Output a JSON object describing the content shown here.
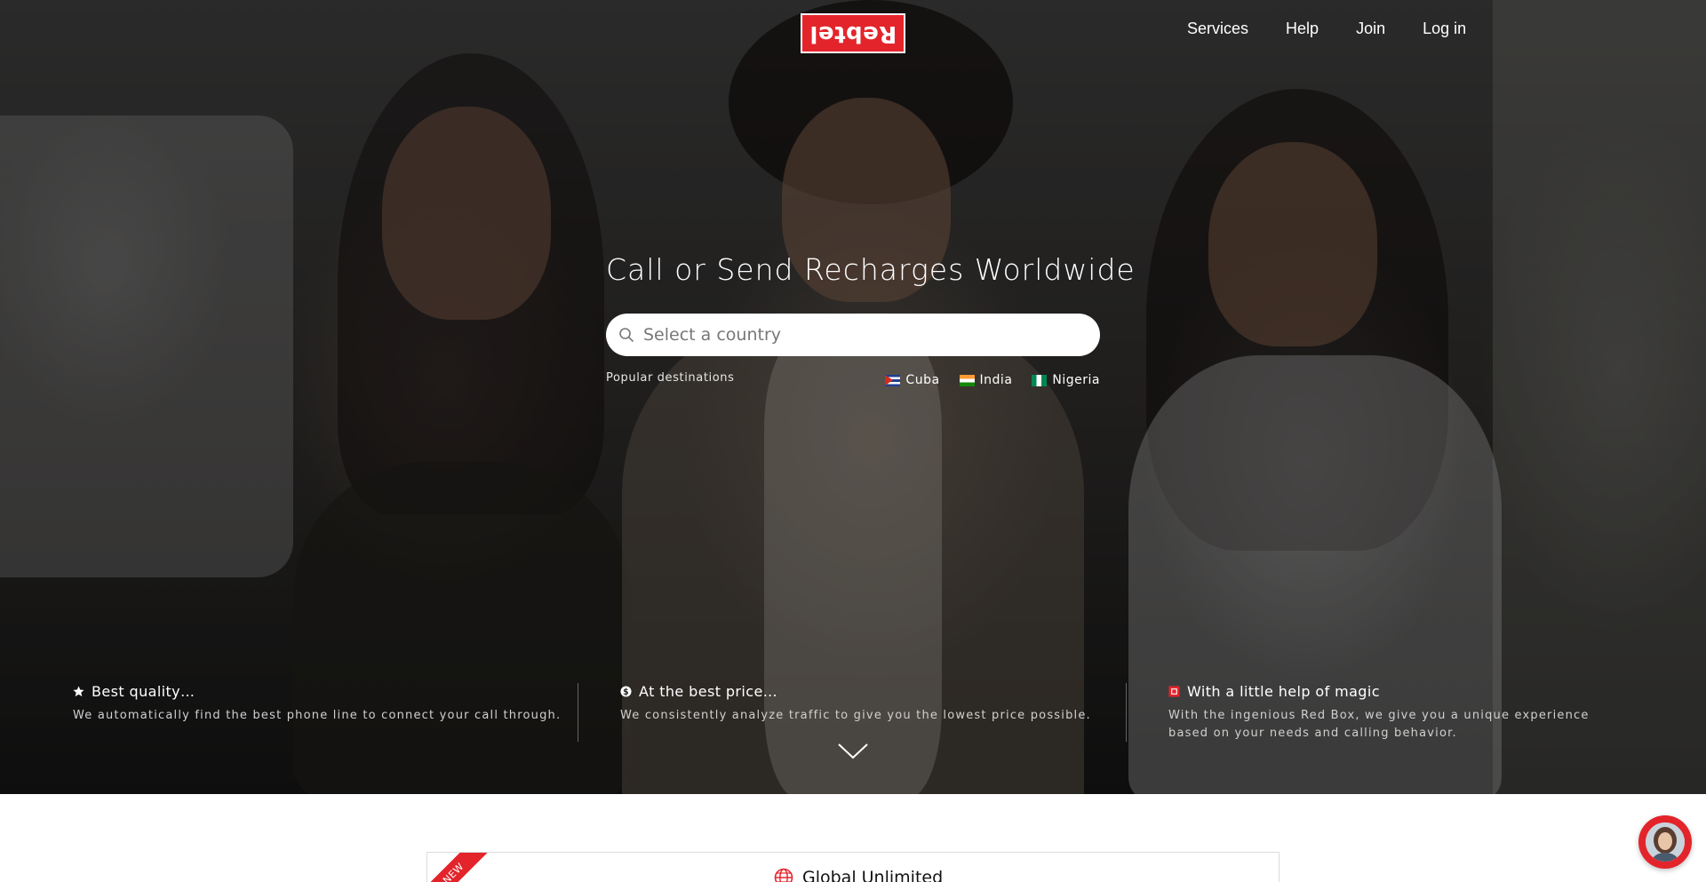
{
  "brand": {
    "logo_text": "Rebtel",
    "accent_color": "#e3242b"
  },
  "nav": {
    "items": [
      {
        "label": "Services"
      },
      {
        "label": "Help"
      },
      {
        "label": "Join"
      },
      {
        "label": "Log in"
      }
    ]
  },
  "hero": {
    "headline": "Call or Send Recharges Worldwide",
    "search": {
      "placeholder": "Select a country",
      "value": "",
      "icon": "search-icon"
    },
    "popular_label": "Popular destinations",
    "destinations": [
      {
        "name": "Cuba",
        "icon": "flag-cuba-icon"
      },
      {
        "name": "India",
        "icon": "flag-india-icon"
      },
      {
        "name": "Nigeria",
        "icon": "flag-nigeria-icon"
      }
    ]
  },
  "features": [
    {
      "icon": "star-icon",
      "title": "Best quality…",
      "description": "We automatically find the best phone line to connect your call through."
    },
    {
      "icon": "dollar-coin-icon",
      "title": "At the best price…",
      "description": "We consistently analyze traffic to give you the lowest price possible."
    },
    {
      "icon": "red-box-icon",
      "title": "With a little help of magic",
      "description": "With the ingenious Red Box, we give you a unique experience based on your needs and calling behavior."
    }
  ],
  "scroll_icon": "chevron-down-icon",
  "card": {
    "ribbon": "NEW",
    "icon": "globe-icon",
    "title": "Global Unlimited"
  },
  "chat": {
    "icon": "support-avatar-icon"
  }
}
